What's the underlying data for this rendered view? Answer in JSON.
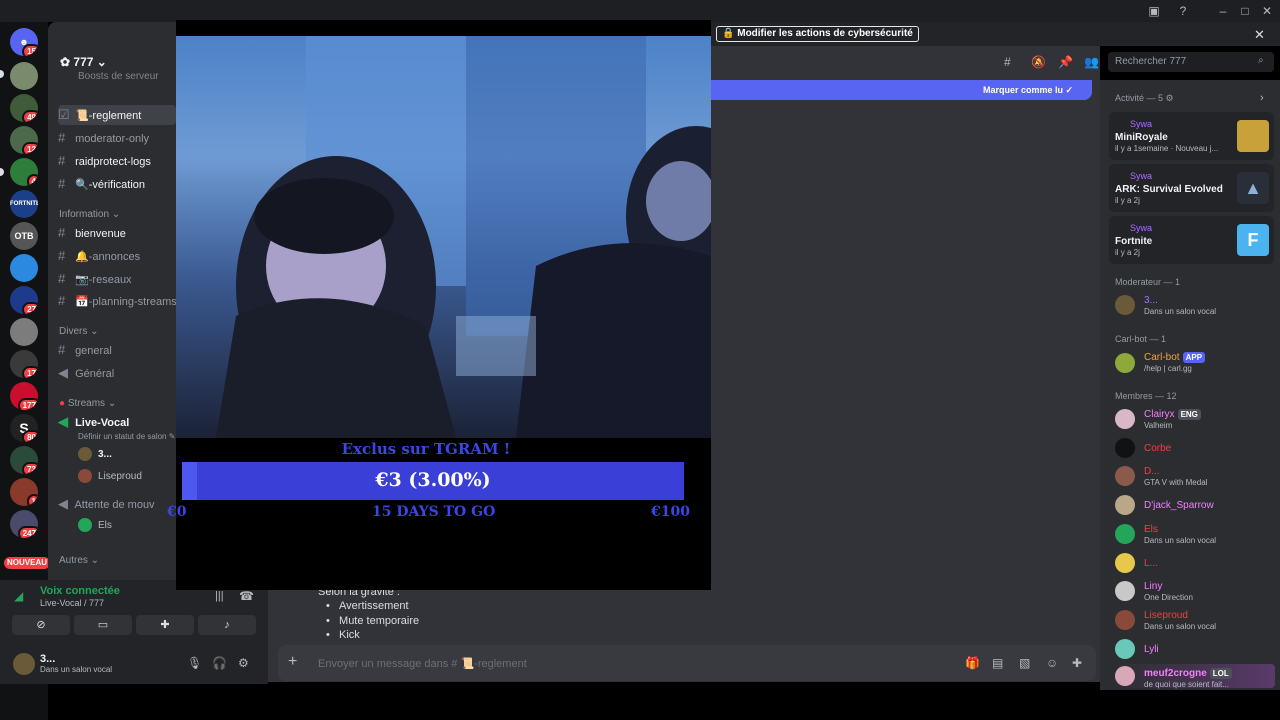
{
  "titlebar": {
    "icons": [
      "inbox-icon",
      "help-icon",
      "minimize-icon",
      "maximize-icon",
      "close-icon"
    ],
    "notice_button": "Modifier les actions de cybersécurité"
  },
  "rail": {
    "badges": [
      "15",
      "49",
      "12",
      "4",
      "27",
      "17",
      "177",
      "80",
      "73",
      "1",
      "247"
    ],
    "new_label": "NOUVEAU",
    "server_labels": {
      "fortnite": "FORTNITE",
      "otb": "OTB",
      "s": "S"
    }
  },
  "sidebar": {
    "server_name": "777",
    "boost_text": "Boosts de serveur",
    "channels_top": [
      {
        "name": "📜-reglement"
      },
      {
        "name": "moderator-only"
      },
      {
        "name": "raidprotect-logs"
      },
      {
        "name": "🔍-vérification"
      }
    ],
    "cat_information": "Information",
    "channels_info": [
      {
        "name": "bienvenue"
      },
      {
        "name": "🔔-annonces"
      },
      {
        "name": "📷-reseaux"
      },
      {
        "name": "📅-planning-streams"
      }
    ],
    "cat_divers": "Divers",
    "channels_divers": [
      {
        "name": "general"
      },
      {
        "name": "Général"
      }
    ],
    "cat_streams": "Streams",
    "live_vocal": "Live-Vocal",
    "live_status": "Définir un statut de salon",
    "voice_users": [
      "3...",
      "Liseproud"
    ],
    "attente": "Attente de mouv",
    "attente_user": "Els",
    "cat_autres": "Autres"
  },
  "voice_panel": {
    "title": "Voix connectée",
    "subtitle": "Live-Vocal / 777",
    "user_name": "3...",
    "user_status": "Dans un salon vocal"
  },
  "chat": {
    "mark_read": "Marquer comme lu",
    "message_intro": "Selon la gravité :",
    "bullets": [
      "Avertissement",
      "Mute temporaire",
      "Kick"
    ],
    "composer_placeholder": "Envoyer un message dans # 📜-reglement",
    "search_placeholder": "Rechercher 777"
  },
  "members": {
    "activity_title": "Activité — 5",
    "activities": [
      {
        "user": "Sywa",
        "game": "MiniRoyale",
        "time": "il y a 1semaine",
        "extra": "Nouveau j..."
      },
      {
        "user": "Sywa",
        "game": "ARK: Survival Evolved",
        "time": "il y a 2j",
        "extra": ""
      },
      {
        "user": "Sywa",
        "game": "Fortnite",
        "time": "il y a 2j",
        "extra": ""
      }
    ],
    "moderator_title": "Moderateur — 1",
    "moderator": {
      "name": "3...",
      "sub": "Dans un salon vocal"
    },
    "carlbot_title": "Carl-bot — 1",
    "carlbot": {
      "name": "Carl-bot",
      "tag": "APP",
      "sub": "/help | carl.gg"
    },
    "members_title": "Membres — 12",
    "list": [
      {
        "name": "Clairyx",
        "tag": "ENG",
        "sub": "Valheim",
        "color": "#f47fff"
      },
      {
        "name": "Corbe",
        "tag": "",
        "sub": "",
        "color": "#f23f43"
      },
      {
        "name": "D...",
        "tag": "",
        "sub": "GTA V with Medal",
        "color": "#f23f43"
      },
      {
        "name": "D'jack_Sparrow",
        "tag": "",
        "sub": "",
        "color": "#f47fff"
      },
      {
        "name": "Els",
        "tag": "",
        "sub": "Dans un salon vocal",
        "color": "#f23f43"
      },
      {
        "name": "L...",
        "tag": "",
        "sub": "",
        "color": "#f23f43"
      },
      {
        "name": "Liny",
        "tag": "",
        "sub": "One Direction",
        "color": "#f47fff"
      },
      {
        "name": "Liseproud",
        "tag": "",
        "sub": "Dans un salon vocal",
        "color": "#f23f43"
      },
      {
        "name": "Lyli",
        "tag": "",
        "sub": "",
        "color": "#f47fff"
      },
      {
        "name": "meuf2crogne",
        "tag": "LOL",
        "sub": "de quoi que soient fait...",
        "color": "#f47fff"
      }
    ]
  },
  "stream": {
    "title": "Exclus sur TGRAM !",
    "amount": "€3 (3.00%)",
    "progress_fraction": 0.03,
    "min": "€0",
    "days": "15 DAYS TO GO",
    "max": "€100"
  }
}
